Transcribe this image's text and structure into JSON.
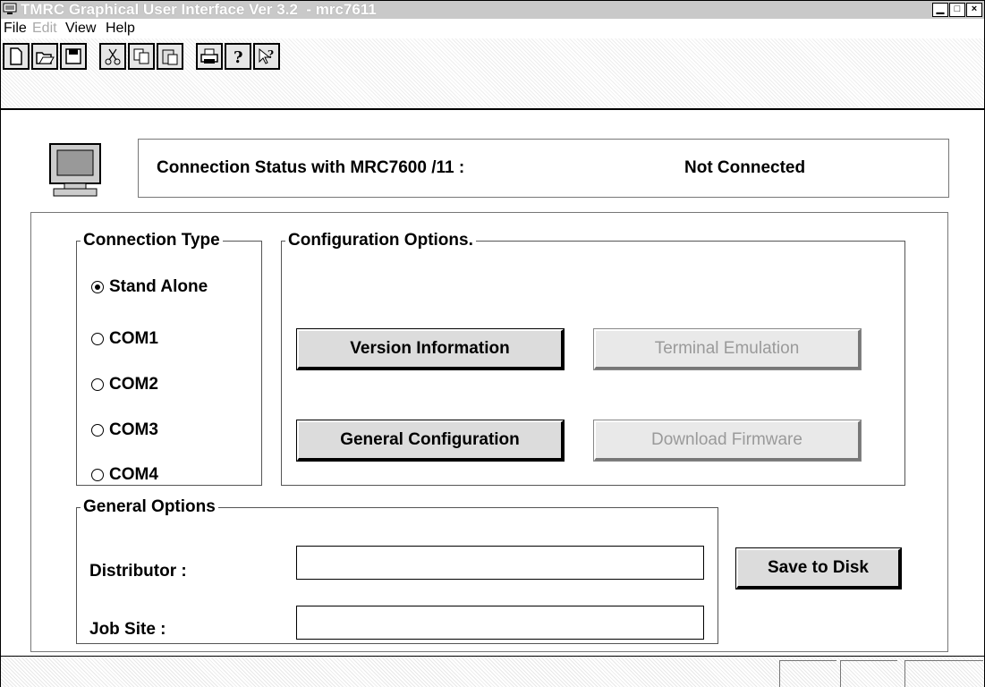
{
  "window": {
    "title": "TMRC Graphical User Interface Ver 3.2  - mrc7611",
    "controls": [
      "minimize",
      "maximize",
      "close"
    ]
  },
  "menu": {
    "file": "File",
    "edit": "Edit",
    "view": "View",
    "help": "Help"
  },
  "toolbar": {
    "icons": [
      "new-icon",
      "open-icon",
      "save-icon",
      "cut-icon",
      "copy-icon",
      "paste-icon",
      "print-icon",
      "about-icon",
      "context-help-icon"
    ]
  },
  "status": {
    "label": "Connection Status with MRC7600 /11 :",
    "value": "Not Connected"
  },
  "connection_type": {
    "legend": "Connection Type",
    "options": [
      "Stand Alone",
      "COM1",
      "COM2",
      "COM3",
      "COM4"
    ],
    "selected": "Stand Alone"
  },
  "config": {
    "legend": "Configuration Options.",
    "version_info": "Version Information",
    "terminal_emulation": "Terminal Emulation",
    "general_config": "General Configuration",
    "download_firmware": "Download Firmware"
  },
  "general_options": {
    "legend": "General Options",
    "distributor_label": "Distributor :",
    "distributor_value": "",
    "job_site_label": "Job Site :",
    "job_site_value": ""
  },
  "save_button": "Save to Disk",
  "colors": {
    "face": "#dcdcdc",
    "disabled_text": "#9a9a9a"
  }
}
